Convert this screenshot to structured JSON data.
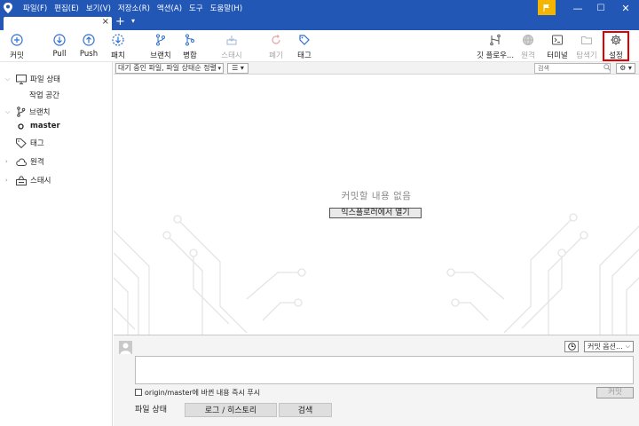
{
  "colors": {
    "titlebar": "#2357b6",
    "flag": "#f5b400",
    "highlight": "#e00000"
  },
  "menu": [
    "파일(F)",
    "편집(E)",
    "보기(V)",
    "저장소(R)",
    "액션(A)",
    "도구",
    "도움말(H)"
  ],
  "window_controls": {
    "minimize": "—",
    "maximize": "☐",
    "close": "✕"
  },
  "tabs": {
    "close_glyph": "×",
    "add_glyph": "+",
    "more_glyph": "▾"
  },
  "toolbar": {
    "commit": "커밋",
    "pull": "Pull",
    "push": "Push",
    "fetch": "패치",
    "branch": "브랜치",
    "merge": "병합",
    "stash": "스태시",
    "discard": "폐기",
    "tag": "태그",
    "gitflow": "깃 플로우...",
    "remote": "원격",
    "terminal": "터미널",
    "explorer": "탐색기",
    "settings": "설정"
  },
  "sidebar": {
    "file_status": "파일 상태",
    "working_copy": "작업 공간",
    "branches": "브랜치",
    "current_branch": "master",
    "tags": "태그",
    "remotes": "원격",
    "stashes": "스태시"
  },
  "filter": {
    "selected": "대기 중인 파일, 파일 상태순 정렬",
    "list_view_glyph": "☰ ▾",
    "search_placeholder": "검색",
    "gear_glyph": "⚙ ▾"
  },
  "main": {
    "empty_message": "커밋할 내용 없음",
    "open_explorer": "익스플로러에서 열기"
  },
  "commit": {
    "options": "커밋 옵션...",
    "push_label": "origin/master에 바뀐 내용 즉시 푸시",
    "button": "커밋"
  },
  "bottom_tabs": {
    "status": "파일 상태",
    "log": "로그 / 히스토리",
    "search": "검색"
  }
}
